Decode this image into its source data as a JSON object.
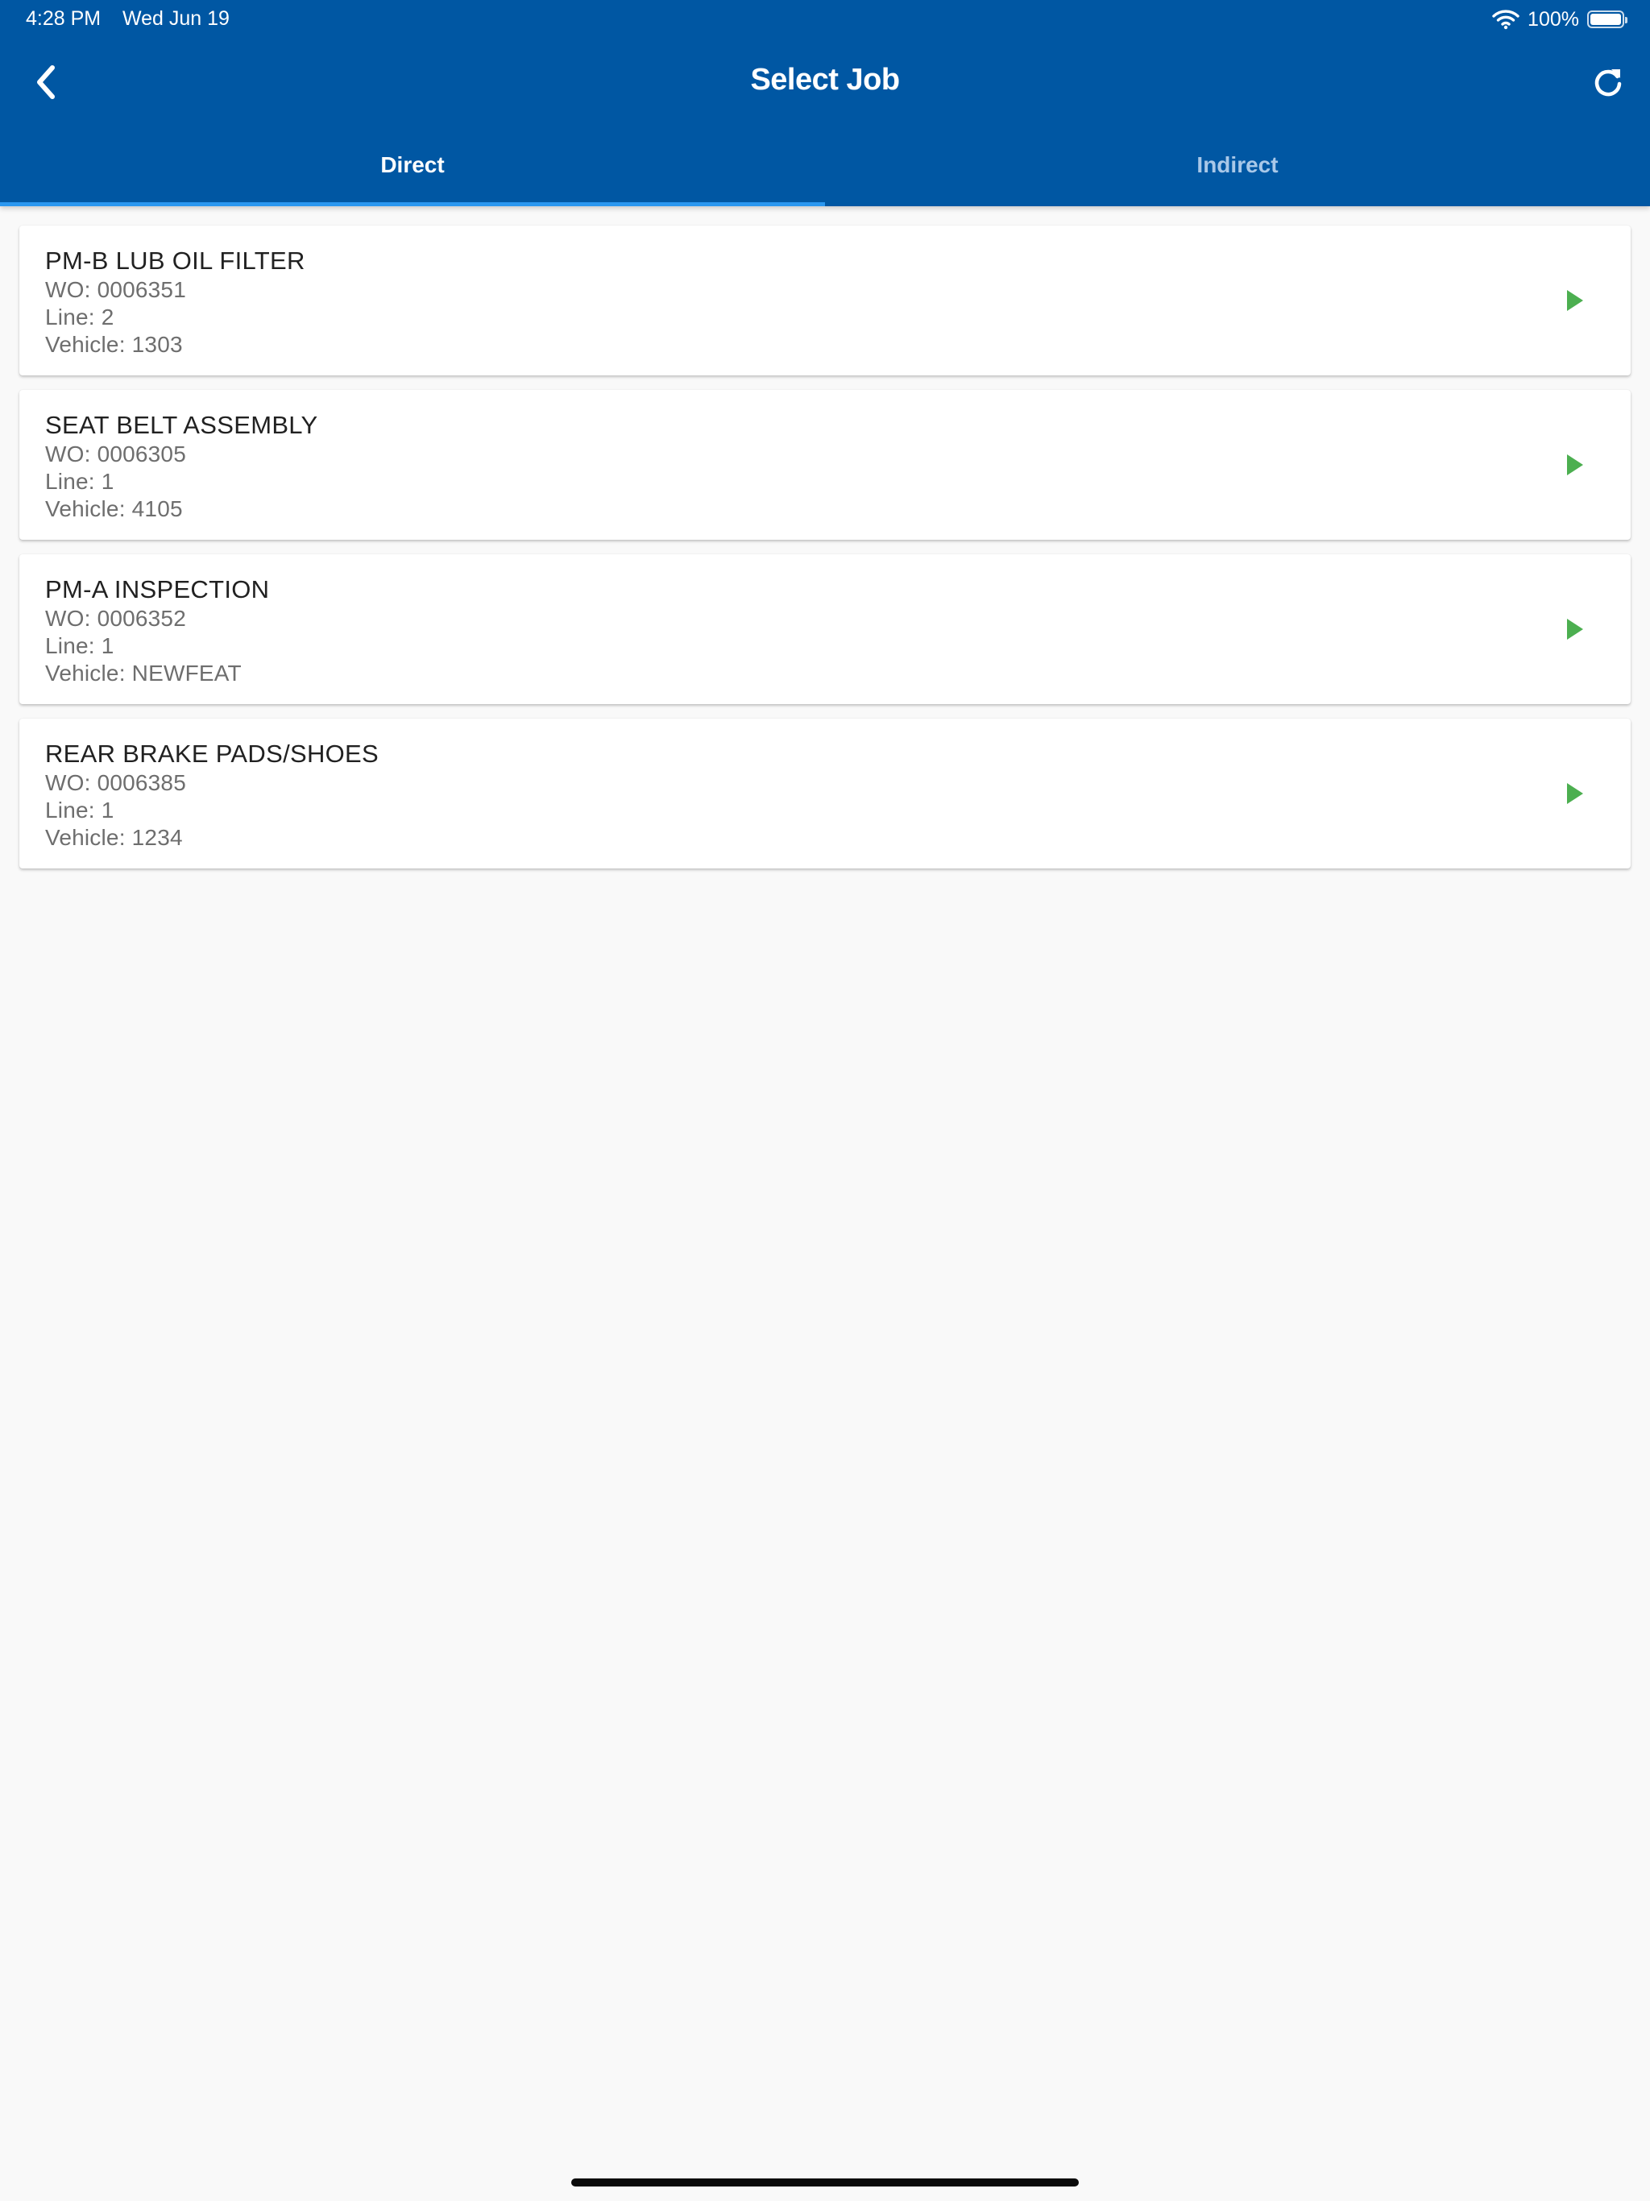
{
  "status_bar": {
    "time": "4:28 PM",
    "date": "Wed Jun 19",
    "battery": "100%",
    "icons": [
      "wifi-icon",
      "battery-icon"
    ]
  },
  "header": {
    "title": "Select Job",
    "back_icon": "chevron-left-icon",
    "refresh_icon": "refresh-icon",
    "color": "#0057a3"
  },
  "tabs": [
    {
      "label": "Direct",
      "active": true
    },
    {
      "label": "Indirect",
      "active": false
    }
  ],
  "colors": {
    "accent": "#2a97f0",
    "play": "#4caf50",
    "background": "#f9f9f9"
  },
  "jobs": [
    {
      "title": "PM-B LUB OIL FILTER",
      "wo": "WO: 0006351",
      "line": "Line: 2",
      "vehicle": "Vehicle: 1303"
    },
    {
      "title": "SEAT BELT ASSEMBLY",
      "wo": "WO: 0006305",
      "line": "Line: 1",
      "vehicle": "Vehicle: 4105"
    },
    {
      "title": "PM-A INSPECTION",
      "wo": "WO: 0006352",
      "line": "Line: 1",
      "vehicle": "Vehicle: NEWFEAT"
    },
    {
      "title": "REAR BRAKE PADS/SHOES",
      "wo": "WO: 0006385",
      "line": "Line: 1",
      "vehicle": "Vehicle: 1234"
    }
  ]
}
